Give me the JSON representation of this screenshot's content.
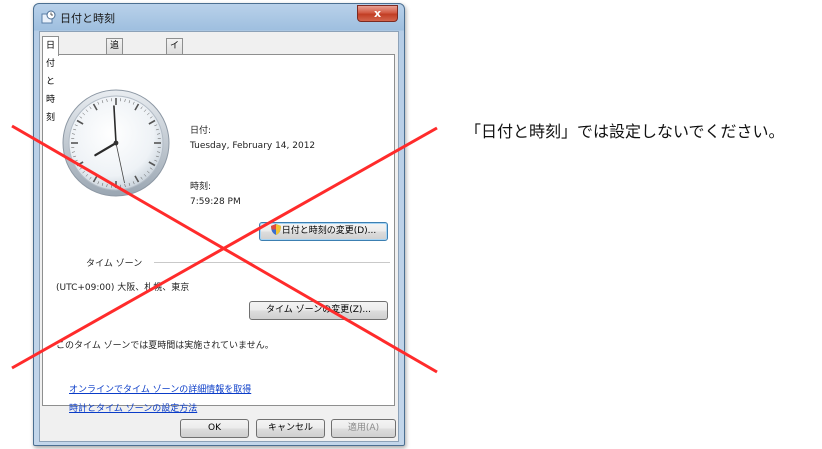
{
  "dialog": {
    "title": "日付と時刻",
    "close_label": "x",
    "tabs": [
      {
        "label": "日付と時刻",
        "active": true
      },
      {
        "label": "追加の時計",
        "active": false
      },
      {
        "label": "インターネット時刻",
        "active": false
      }
    ],
    "date_label": "日付:",
    "date_value": "Tuesday, February 14, 2012",
    "time_label": "時刻:",
    "time_value": "7:59:28 PM",
    "change_datetime_button": "日付と時刻の変更(D)...",
    "timezone_heading": "タイム ゾーン",
    "timezone_value": "(UTC+09:00) 大阪、札幌、東京",
    "change_timezone_button": "タイム ゾーンの変更(Z)...",
    "dst_message": "このタイム ゾーンでは夏時間は実施されていません。",
    "links": [
      "オンラインでタイム ゾーンの詳細情報を取得",
      "時計とタイム ゾーンの設定方法"
    ],
    "ok_button": "OK",
    "cancel_button": "キャンセル",
    "apply_button": "適用(A)"
  },
  "clock": {
    "hour": 7,
    "minute": 59,
    "second": 28
  },
  "annotation": {
    "text": "「日付と時刻」では設定しないでください。"
  },
  "colors": {
    "cross": "#ff2b2b",
    "link": "#0a3cc8",
    "frame": "#9fbfdf"
  }
}
